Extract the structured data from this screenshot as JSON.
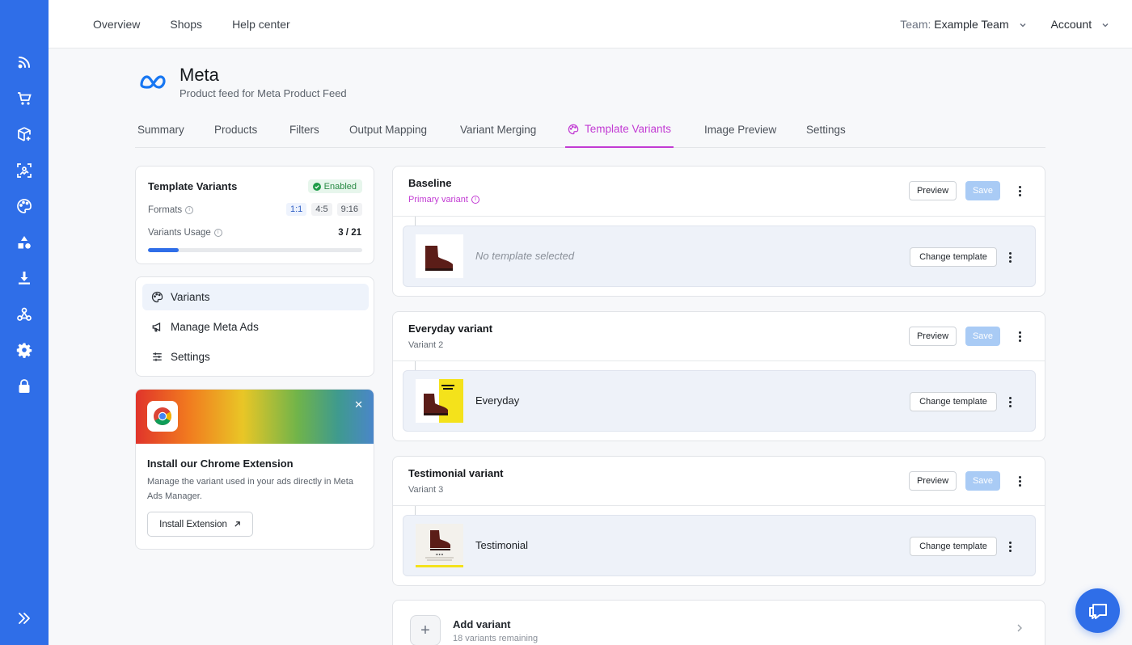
{
  "topnav": {
    "overview": "Overview",
    "shops": "Shops",
    "help": "Help center"
  },
  "team": {
    "label": "Team:",
    "name": "Example Team"
  },
  "account": "Account",
  "header": {
    "title": "Meta",
    "subtitle": "Product feed for Meta Product Feed"
  },
  "tabs": [
    "Summary",
    "Products",
    "Filters",
    "Output Mapping",
    "Variant Merging",
    "Template Variants",
    "Image Preview",
    "Settings"
  ],
  "active_tab": "Template Variants",
  "summary": {
    "title": "Template Variants",
    "status": "Enabled",
    "formats_label": "Formats",
    "formats": [
      "1:1",
      "4:5",
      "9:16"
    ],
    "active_format": "1:1",
    "usage_label": "Variants Usage",
    "usage_value": "3 / 21",
    "usage_fraction": 0.143
  },
  "side_menu": [
    "Variants",
    "Manage Meta Ads",
    "Settings"
  ],
  "extension": {
    "title": "Install our Chrome Extension",
    "body": "Manage the variant used in your ads directly in Meta Ads Manager.",
    "button": "Install Extension"
  },
  "variants": [
    {
      "name": "Baseline",
      "sub": "Primary variant",
      "template": "No template selected"
    },
    {
      "name": "Everyday variant",
      "sub": "Variant 2",
      "template": "Everyday"
    },
    {
      "name": "Testimonial variant",
      "sub": "Variant 3",
      "template": "Testimonial"
    }
  ],
  "variant_buttons": {
    "preview": "Preview",
    "save": "Save",
    "change": "Change template"
  },
  "add_variant": {
    "title": "Add variant",
    "sub": "18 variants remaining"
  },
  "colors": {
    "rail": "#2f6ee8",
    "accent": "#c23bd3",
    "enabled": "#1f9c48",
    "save_disabled": "#a9cbf5"
  }
}
